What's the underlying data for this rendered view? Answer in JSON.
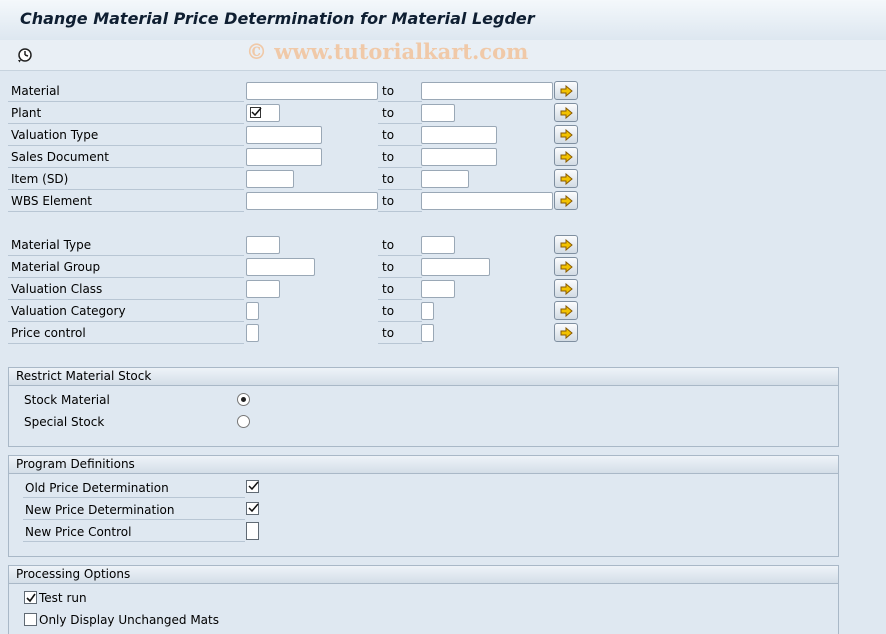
{
  "header": {
    "title": "Change Material Price Determination for Material Legder",
    "watermark": "© www.tutorialkart.com"
  },
  "toolbar": {
    "execute_icon": "execute-clock-icon"
  },
  "selection": {
    "to_label": "to",
    "rows": [
      {
        "label": "Material"
      },
      {
        "label": "Plant"
      },
      {
        "label": "Valuation Type"
      },
      {
        "label": "Sales Document"
      },
      {
        "label": "Item (SD)"
      },
      {
        "label": "WBS Element"
      },
      {
        "label": "Material Type"
      },
      {
        "label": "Material Group"
      },
      {
        "label": "Valuation Class"
      },
      {
        "label": "Valuation Category"
      },
      {
        "label": "Price control"
      }
    ]
  },
  "restrict_stock": {
    "title": "Restrict Material Stock",
    "options": [
      {
        "label": "Stock Material",
        "selected": true
      },
      {
        "label": "Special Stock",
        "selected": false
      }
    ]
  },
  "program_definitions": {
    "title": "Program Definitions",
    "items": [
      {
        "label": "Old Price Determination",
        "checked": true
      },
      {
        "label": "New Price Determination",
        "checked": true
      },
      {
        "label": "New Price Control",
        "checked": false
      }
    ]
  },
  "processing_options": {
    "title": "Processing Options",
    "items": [
      {
        "label": "Test run",
        "checked": true
      },
      {
        "label": "Only Display Unchanged Mats",
        "checked": false
      }
    ]
  },
  "colors": {
    "arrow_fill": "#f2c200",
    "arrow_stroke": "#8a5a00",
    "watermark": "#f0c9a8"
  }
}
